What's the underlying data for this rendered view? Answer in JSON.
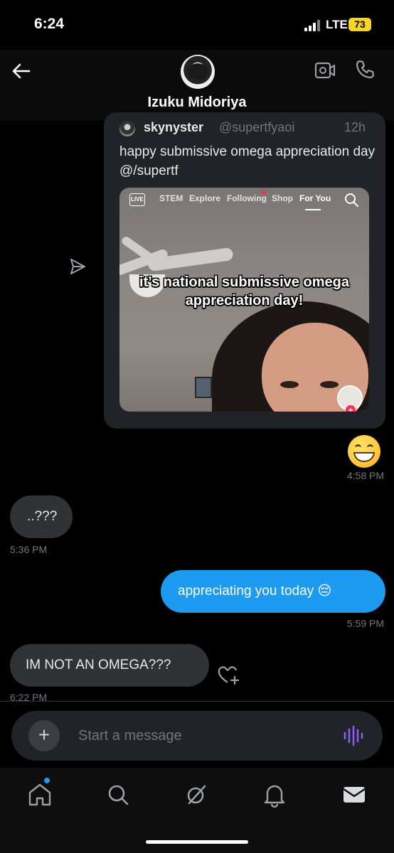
{
  "status_bar": {
    "time": "6:24",
    "network": "LTE",
    "battery": "73"
  },
  "header": {
    "contact_name": "Izuku Midoriya"
  },
  "shared_post": {
    "author_name": "skynyster",
    "author_handle": "@supertfyaoi",
    "time": "12h",
    "text": "happy submissive omega appreciation day @/supertf",
    "video": {
      "nav_live": "LIVE",
      "nav_tabs": [
        "STEM",
        "Explore",
        "Following",
        "Shop",
        "For You"
      ],
      "active_tab": "For You",
      "caption": "it’s national submissive omega appreciation day!"
    }
  },
  "messages": [
    {
      "direction": "out",
      "type": "emoji",
      "text": "😁",
      "time": "4:58 PM"
    },
    {
      "direction": "in",
      "type": "text",
      "text": "..???",
      "time": "5:36 PM"
    },
    {
      "direction": "out",
      "type": "text",
      "text": "appreciating you today 😔",
      "time": "5:59 PM"
    },
    {
      "direction": "in",
      "type": "text",
      "text": "IM NOT AN OMEGA???",
      "time": "6:22 PM"
    }
  ],
  "composer": {
    "placeholder": "Start a message"
  },
  "colors": {
    "accent": "#1d9bf0",
    "incoming_bubble": "#2f3336",
    "voice": "#8b5cf6"
  },
  "icons": [
    "back-arrow-icon",
    "video-call-icon",
    "phone-icon",
    "send-share-icon",
    "heart-plus-icon",
    "plus-icon",
    "voice-wave-icon",
    "home-icon",
    "search-icon",
    "grok-icon",
    "bell-icon",
    "mail-icon"
  ]
}
